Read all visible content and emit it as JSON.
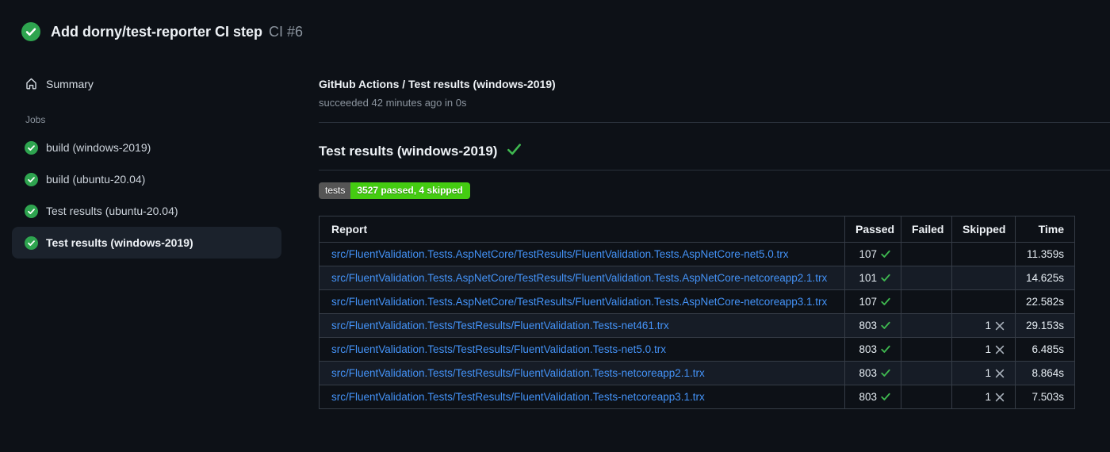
{
  "colors": {
    "page_bg": "#0d1117",
    "circle_green": "#2ea44f",
    "check_green": "#3fb950",
    "link_blue": "#4493f8",
    "badge_label_bg": "#555555",
    "badge_value_bg": "#44cc11",
    "selected_item_bg": "#1b222c",
    "row_alt_bg": "#161c26",
    "muted_text": "#8b949e"
  },
  "header": {
    "status_icon": "check-circle-icon",
    "title": "Add dorny/test-reporter CI step",
    "run_ref": "CI #6"
  },
  "sidebar": {
    "summary": {
      "icon": "home-icon",
      "label": "Summary"
    },
    "jobs_heading": "Jobs",
    "jobs": [
      {
        "icon": "check-circle-icon",
        "label": "build (windows-2019)",
        "selected": false
      },
      {
        "icon": "check-circle-icon",
        "label": "build (ubuntu-20.04)",
        "selected": false
      },
      {
        "icon": "check-circle-icon",
        "label": "Test results (ubuntu-20.04)",
        "selected": false
      },
      {
        "icon": "check-circle-icon",
        "label": "Test results (windows-2019)",
        "selected": true
      }
    ]
  },
  "main": {
    "job_header": {
      "title": "GitHub Actions / Test results (windows-2019)",
      "status_line": "succeeded 42 minutes ago in 0s"
    },
    "section": {
      "heading": "Test results (windows-2019)",
      "heading_icon": "check-icon",
      "badge": {
        "label": "tests",
        "value": "3527 passed, 4 skipped"
      },
      "table": {
        "columns": [
          "Report",
          "Passed",
          "Failed",
          "Skipped",
          "Time"
        ],
        "rows": [
          {
            "report": "src/FluentValidation.Tests.AspNetCore/TestResults/FluentValidation.Tests.AspNetCore-net5.0.trx",
            "passed": "107",
            "failed": "",
            "skipped": "",
            "time": "11.359s"
          },
          {
            "report": "src/FluentValidation.Tests.AspNetCore/TestResults/FluentValidation.Tests.AspNetCore-netcoreapp2.1.trx",
            "passed": "101",
            "failed": "",
            "skipped": "",
            "time": "14.625s"
          },
          {
            "report": "src/FluentValidation.Tests.AspNetCore/TestResults/FluentValidation.Tests.AspNetCore-netcoreapp3.1.trx",
            "passed": "107",
            "failed": "",
            "skipped": "",
            "time": "22.582s"
          },
          {
            "report": "src/FluentValidation.Tests/TestResults/FluentValidation.Tests-net461.trx",
            "passed": "803",
            "failed": "",
            "skipped": "1",
            "time": "29.153s"
          },
          {
            "report": "src/FluentValidation.Tests/TestResults/FluentValidation.Tests-net5.0.trx",
            "passed": "803",
            "failed": "",
            "skipped": "1",
            "time": "6.485s"
          },
          {
            "report": "src/FluentValidation.Tests/TestResults/FluentValidation.Tests-netcoreapp2.1.trx",
            "passed": "803",
            "failed": "",
            "skipped": "1",
            "time": "8.864s"
          },
          {
            "report": "src/FluentValidation.Tests/TestResults/FluentValidation.Tests-netcoreapp3.1.trx",
            "passed": "803",
            "failed": "",
            "skipped": "1",
            "time": "7.503s"
          }
        ]
      }
    }
  }
}
